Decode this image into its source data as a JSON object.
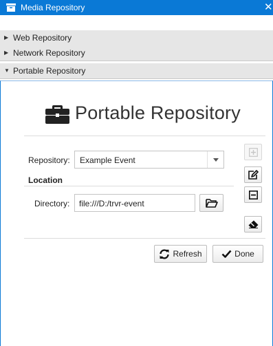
{
  "window": {
    "title": "Media Repository",
    "close_glyph": "✕"
  },
  "sections": [
    {
      "label": "Web Repository",
      "expanded": false
    },
    {
      "label": "Network Repository",
      "expanded": false
    },
    {
      "label": "Portable Repository",
      "expanded": true
    }
  ],
  "portable": {
    "heading": "Portable Repository",
    "repository_label": "Repository:",
    "repository_value": "Example Event",
    "location_heading": "Location",
    "directory_label": "Directory:",
    "directory_value": "file:///D:/trvr-event",
    "refresh_label": "Refresh",
    "done_label": "Done"
  },
  "icons": {
    "window": "archive-box-icon",
    "heading": "briefcase-icon",
    "combo": "chevron-down-icon",
    "browse": "folder-open-icon",
    "add": "plus-square-icon",
    "edit": "edit-icon",
    "remove": "minus-square-icon",
    "clear": "eraser-icon",
    "refresh": "refresh-icon",
    "done": "check-icon"
  },
  "colors": {
    "accent": "#0a79d6",
    "section_bg": "#e6e6e6"
  }
}
